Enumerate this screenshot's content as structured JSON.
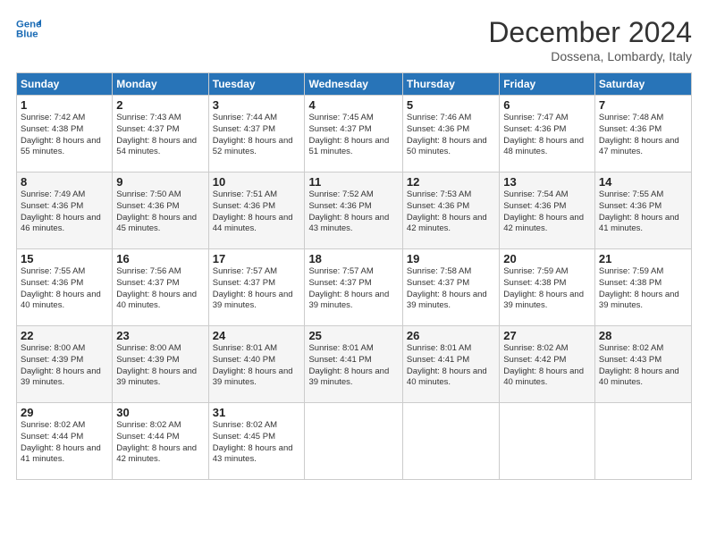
{
  "header": {
    "logo_line1": "General",
    "logo_line2": "Blue",
    "month": "December 2024",
    "location": "Dossena, Lombardy, Italy"
  },
  "days_of_week": [
    "Sunday",
    "Monday",
    "Tuesday",
    "Wednesday",
    "Thursday",
    "Friday",
    "Saturday"
  ],
  "weeks": [
    [
      {
        "day": "1",
        "sunrise": "7:42 AM",
        "sunset": "4:38 PM",
        "daylight": "8 hours and 55 minutes."
      },
      {
        "day": "2",
        "sunrise": "7:43 AM",
        "sunset": "4:37 PM",
        "daylight": "8 hours and 54 minutes."
      },
      {
        "day": "3",
        "sunrise": "7:44 AM",
        "sunset": "4:37 PM",
        "daylight": "8 hours and 52 minutes."
      },
      {
        "day": "4",
        "sunrise": "7:45 AM",
        "sunset": "4:37 PM",
        "daylight": "8 hours and 51 minutes."
      },
      {
        "day": "5",
        "sunrise": "7:46 AM",
        "sunset": "4:36 PM",
        "daylight": "8 hours and 50 minutes."
      },
      {
        "day": "6",
        "sunrise": "7:47 AM",
        "sunset": "4:36 PM",
        "daylight": "8 hours and 48 minutes."
      },
      {
        "day": "7",
        "sunrise": "7:48 AM",
        "sunset": "4:36 PM",
        "daylight": "8 hours and 47 minutes."
      }
    ],
    [
      {
        "day": "8",
        "sunrise": "7:49 AM",
        "sunset": "4:36 PM",
        "daylight": "8 hours and 46 minutes."
      },
      {
        "day": "9",
        "sunrise": "7:50 AM",
        "sunset": "4:36 PM",
        "daylight": "8 hours and 45 minutes."
      },
      {
        "day": "10",
        "sunrise": "7:51 AM",
        "sunset": "4:36 PM",
        "daylight": "8 hours and 44 minutes."
      },
      {
        "day": "11",
        "sunrise": "7:52 AM",
        "sunset": "4:36 PM",
        "daylight": "8 hours and 43 minutes."
      },
      {
        "day": "12",
        "sunrise": "7:53 AM",
        "sunset": "4:36 PM",
        "daylight": "8 hours and 42 minutes."
      },
      {
        "day": "13",
        "sunrise": "7:54 AM",
        "sunset": "4:36 PM",
        "daylight": "8 hours and 42 minutes."
      },
      {
        "day": "14",
        "sunrise": "7:55 AM",
        "sunset": "4:36 PM",
        "daylight": "8 hours and 41 minutes."
      }
    ],
    [
      {
        "day": "15",
        "sunrise": "7:55 AM",
        "sunset": "4:36 PM",
        "daylight": "8 hours and 40 minutes."
      },
      {
        "day": "16",
        "sunrise": "7:56 AM",
        "sunset": "4:37 PM",
        "daylight": "8 hours and 40 minutes."
      },
      {
        "day": "17",
        "sunrise": "7:57 AM",
        "sunset": "4:37 PM",
        "daylight": "8 hours and 39 minutes."
      },
      {
        "day": "18",
        "sunrise": "7:57 AM",
        "sunset": "4:37 PM",
        "daylight": "8 hours and 39 minutes."
      },
      {
        "day": "19",
        "sunrise": "7:58 AM",
        "sunset": "4:37 PM",
        "daylight": "8 hours and 39 minutes."
      },
      {
        "day": "20",
        "sunrise": "7:59 AM",
        "sunset": "4:38 PM",
        "daylight": "8 hours and 39 minutes."
      },
      {
        "day": "21",
        "sunrise": "7:59 AM",
        "sunset": "4:38 PM",
        "daylight": "8 hours and 39 minutes."
      }
    ],
    [
      {
        "day": "22",
        "sunrise": "8:00 AM",
        "sunset": "4:39 PM",
        "daylight": "8 hours and 39 minutes."
      },
      {
        "day": "23",
        "sunrise": "8:00 AM",
        "sunset": "4:39 PM",
        "daylight": "8 hours and 39 minutes."
      },
      {
        "day": "24",
        "sunrise": "8:01 AM",
        "sunset": "4:40 PM",
        "daylight": "8 hours and 39 minutes."
      },
      {
        "day": "25",
        "sunrise": "8:01 AM",
        "sunset": "4:41 PM",
        "daylight": "8 hours and 39 minutes."
      },
      {
        "day": "26",
        "sunrise": "8:01 AM",
        "sunset": "4:41 PM",
        "daylight": "8 hours and 40 minutes."
      },
      {
        "day": "27",
        "sunrise": "8:02 AM",
        "sunset": "4:42 PM",
        "daylight": "8 hours and 40 minutes."
      },
      {
        "day": "28",
        "sunrise": "8:02 AM",
        "sunset": "4:43 PM",
        "daylight": "8 hours and 40 minutes."
      }
    ],
    [
      {
        "day": "29",
        "sunrise": "8:02 AM",
        "sunset": "4:44 PM",
        "daylight": "8 hours and 41 minutes."
      },
      {
        "day": "30",
        "sunrise": "8:02 AM",
        "sunset": "4:44 PM",
        "daylight": "8 hours and 42 minutes."
      },
      {
        "day": "31",
        "sunrise": "8:02 AM",
        "sunset": "4:45 PM",
        "daylight": "8 hours and 43 minutes."
      },
      null,
      null,
      null,
      null
    ]
  ],
  "labels": {
    "sunrise": "Sunrise:",
    "sunset": "Sunset:",
    "daylight": "Daylight:"
  }
}
